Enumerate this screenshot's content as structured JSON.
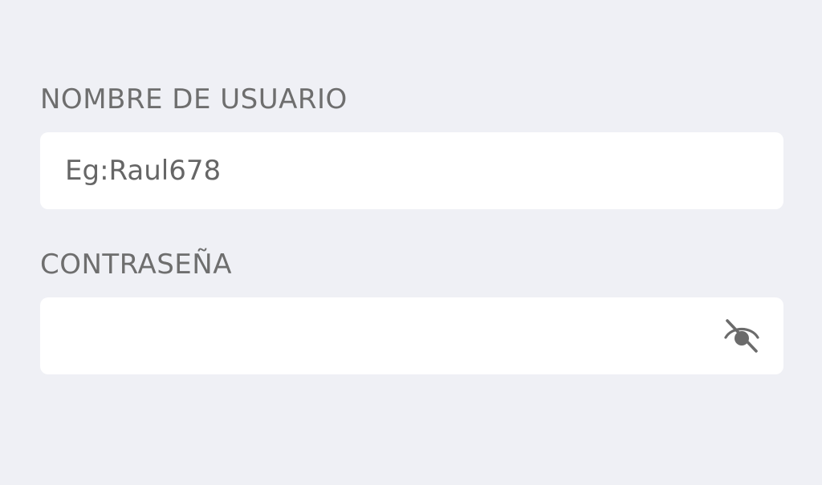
{
  "login_form": {
    "username": {
      "label": "NOMBRE DE USUARIO",
      "placeholder": "Eg:Raul678",
      "value": ""
    },
    "password": {
      "label": "CONTRASEÑA",
      "placeholder": "",
      "value": "",
      "visibility_icon": "eye-off-icon"
    }
  },
  "colors": {
    "background": "#eff0f5",
    "field_background": "#ffffff",
    "label_text": "#6e6e6e",
    "icon": "#6b6b6b"
  }
}
